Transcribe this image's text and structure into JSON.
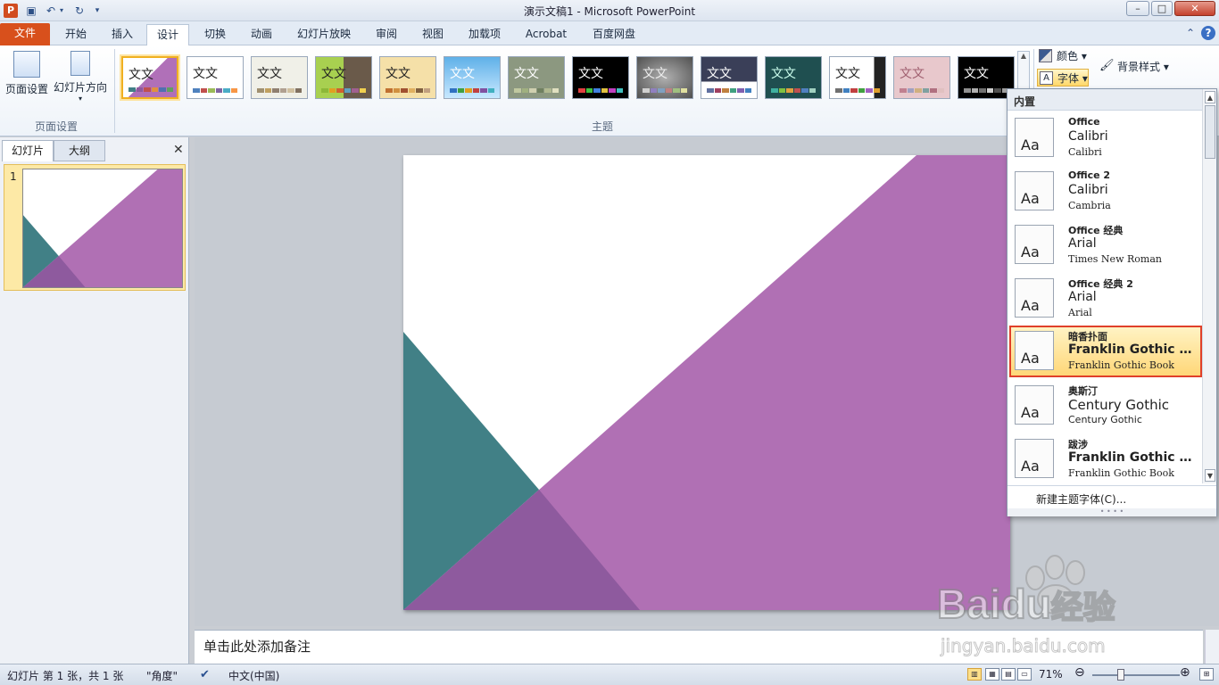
{
  "window": {
    "app_icon": "P",
    "title": "演示文稿1  -  Microsoft PowerPoint",
    "min": "–",
    "max": "□",
    "close": "✕"
  },
  "tabs": [
    "文件",
    "开始",
    "插入",
    "设计",
    "切换",
    "动画",
    "幻灯片放映",
    "审阅",
    "视图",
    "加载项",
    "Acrobat",
    "百度网盘"
  ],
  "active_tab": "设计",
  "ribbon": {
    "page_setup_label": "页面设置",
    "slide_orientation_label": "幻灯片方向",
    "group_page_setup": "页面设置",
    "group_theme": "主题",
    "theme_sample_text": "文文",
    "colors_label": "颜色",
    "fonts_label": "字体",
    "bg_style_label": "背景样式"
  },
  "theme_colors": [
    "#b070b8",
    "#ffffff",
    "#f0f0e8",
    "#a8d050",
    "#f5e0a8",
    "#5fb0e8",
    "#8c9880",
    "#000000",
    "#7a7a7a",
    "#3a3f58",
    "#1f4f50",
    "#ffffff",
    "#e8c8cc",
    "#000000"
  ],
  "left_pane": {
    "tab_slides": "幻灯片",
    "tab_outline": "大纲",
    "close": "✕",
    "slide_number": "1"
  },
  "slide_colors": {
    "purple": "#b070b4",
    "teal": "#418086",
    "dark_purple": "#8e5a9e"
  },
  "notes_placeholder": "单击此处添加备注",
  "status": {
    "slide_info": "幻灯片 第 1 张，共 1 张",
    "theme_name": "\"角度\"",
    "language": "中文(中国)",
    "zoom": "71%"
  },
  "font_menu": {
    "header": "内置",
    "items": [
      {
        "name": "Office",
        "heading": "Calibri",
        "body": "Calibri"
      },
      {
        "name": "Office 2",
        "heading": "Calibri",
        "body": "Cambria"
      },
      {
        "name": "Office 经典",
        "heading": "Arial",
        "body": "Times New Roman"
      },
      {
        "name": "Office 经典 2",
        "heading": "Arial",
        "body": "Arial"
      },
      {
        "name": "暗香扑面",
        "heading": "Franklin Gothic M...",
        "body": "Franklin Gothic Book"
      },
      {
        "name": "奥斯汀",
        "heading": "Century Gothic",
        "body": "Century Gothic"
      },
      {
        "name": "跋涉",
        "heading": "Franklin Gothic M...",
        "body": "Franklin Gothic Book"
      }
    ],
    "sample": "Aa",
    "new_font_label": "新建主题字体(C)..."
  },
  "watermark": {
    "brand": "Baidu",
    "suffix": "经验",
    "url": "jingyan.baidu.com"
  }
}
